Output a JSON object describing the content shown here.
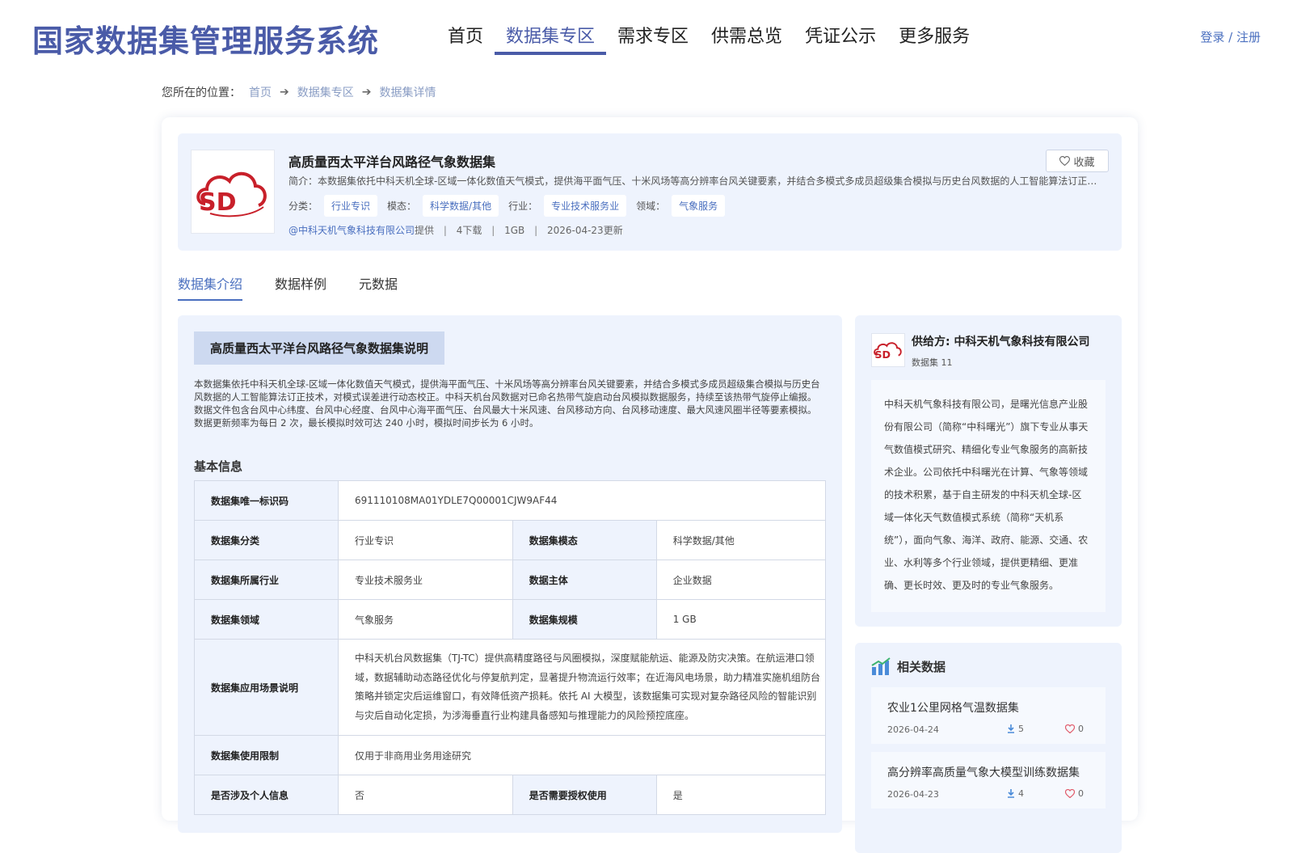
{
  "header": {
    "logo": "国家数据集管理服务系统",
    "nav": [
      "首页",
      "数据集专区",
      "需求专区",
      "供需总览",
      "凭证公示",
      "更多服务"
    ],
    "active_nav": 1,
    "login": "登录 / 注册"
  },
  "breadcrumb": {
    "prefix": "您所在的位置：",
    "items": [
      "首页",
      "数据集专区",
      "数据集详情"
    ]
  },
  "dataset": {
    "title": "高质量西太平洋台风路径气象数据集",
    "desc": "简介：本数据集依托中科天机全球-区域一体化数值天气模式，提供海平面气压、十米风场等高分辨率台风关键要素，并结合多模式多成员超级集合模拟与历史台风数据的人工智能算法订正技术，对模式误差进行动态校正。",
    "tags": [
      {
        "label": "分类：",
        "value": "行业专识"
      },
      {
        "label": "模态：",
        "value": "科学数据/其他"
      },
      {
        "label": "行业：",
        "value": "专业技术服务业"
      },
      {
        "label": "领域：",
        "value": "气象服务"
      }
    ],
    "provider": "@中科天机气象科技有限公司",
    "provider_suffix": "提供",
    "downloads": "4下载",
    "size": "1GB",
    "updated": "2026-04-23更新",
    "fav_label": "收藏",
    "logo_text": "SD"
  },
  "tabs": [
    "数据集介绍",
    "数据样例",
    "元数据"
  ],
  "active_tab": 0,
  "intro": {
    "title": "高质量西太平洋台风路径气象数据集说明",
    "text": "本数据集依托中科天机全球-区域一体化数值天气模式，提供海平面气压、十米风场等高分辨率台风关键要素，并结合多模式多成员超级集合模拟与历史台风数据的人工智能算法订正技术，对模式误差进行动态校正。中科天机台风数据对已命名热带气旋启动台风模拟数据服务，持续至该热带气旋停止编报。数据文件包含台风中心纬度、台风中心经度、台风中心海平面气压、台风最大十米风速、台风移动方向、台风移动速度、最大风速风圈半径等要素模拟。数据更新频率为每日 2 次，最长模拟时效可达 240 小时，模拟时间步长为 6 小时。"
  },
  "basic": {
    "title": "基本信息",
    "id_key": "数据集唯一标识码",
    "id_val": "691110108MA01YDLE7Q00001CJW9AF44",
    "rows": [
      {
        "k1": "数据集分类",
        "v1": "行业专识",
        "k2": "数据集模态",
        "v2": "科学数据/其他"
      },
      {
        "k1": "数据集所属行业",
        "v1": "专业技术服务业",
        "k2": "数据主体",
        "v2": "企业数据"
      },
      {
        "k1": "数据集领域",
        "v1": "气象服务",
        "k2": "数据集规模",
        "v2": "1 GB"
      }
    ],
    "scene_key": "数据集应用场景说明",
    "scene_val": "中科天机台风数据集（TJ-TC）提供高精度路径与风圈模拟，深度赋能航运、能源及防灾决策。在航运港口领域，数据辅助动态路径优化与停复航判定，显著提升物流运行效率；在近海风电场景，助力精准实施机组防台策略并锁定灾后运维窗口，有效降低资产损耗。依托 AI 大模型，该数据集可实现对复杂路径风险的智能识别与灾后自动化定损，为涉海垂直行业构建具备感知与推理能力的风险预控底座。",
    "limit_key": "数据集使用限制",
    "limit_val": "仅用于非商用业务用途研究",
    "last": {
      "k1": "是否涉及个人信息",
      "v1": "否",
      "k2": "是否需要授权使用",
      "v2": "是"
    }
  },
  "supplier": {
    "name": "供给方: 中科天机气象科技有限公司",
    "count": "数据集 11",
    "desc": "中科天机气象科技有限公司，是曙光信息产业股份有限公司（简称“中科曙光”）旗下专业从事天气数值模式研究、精细化专业气象服务的高新技术企业。公司依托中科曙光在计算、气象等领域的技术积累，基于自主研发的中科天机全球-区域一体化天气数值模式系统（简称“天机系统”），面向气象、海洋、政府、能源、交通、农业、水利等多个行业领域，提供更精细、更准确、更长时效、更及时的专业气象服务。"
  },
  "related": {
    "title": "相关数据",
    "items": [
      {
        "title": "农业1公里网格气温数据集",
        "date": "2026-04-24",
        "downloads": "5",
        "likes": "0"
      },
      {
        "title": "高分辨率高质量气象大模型训练数据集",
        "date": "2026-04-23",
        "downloads": "4",
        "likes": "0"
      }
    ]
  },
  "colors": {
    "brand": "#4a5ba8",
    "link": "#4a6fbf",
    "panel": "#eef3fd",
    "logo_red": "#c8202a"
  }
}
